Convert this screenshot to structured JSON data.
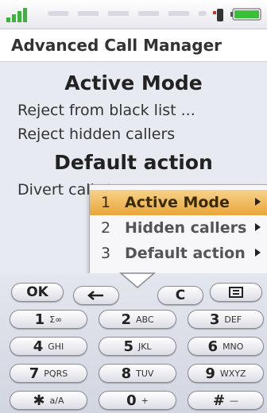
{
  "title": "Advanced Call Manager",
  "content": {
    "heading_active": "Active Mode",
    "item_blacklist": "Reject from black list ...",
    "item_hidden": "Reject hidden callers",
    "heading_default": "Default action",
    "item_divert": "Divert calls to"
  },
  "menu": [
    {
      "num": "1",
      "label": "Active Mode"
    },
    {
      "num": "2",
      "label": "Hidden callers"
    },
    {
      "num": "3",
      "label": "Default action"
    }
  ],
  "keys": {
    "ok": "OK",
    "c": "C",
    "k1": "1",
    "k1s": "Σ∞",
    "k2": "2",
    "k2s": "ABC",
    "k3": "3",
    "k3s": "DEF",
    "k4": "4",
    "k4s": "GHI",
    "k5": "5",
    "k5s": "JKL",
    "k6": "6",
    "k6s": "MNO",
    "k7": "7",
    "k7s": "PQRS",
    "k8": "8",
    "k8s": "TUV",
    "k9": "9",
    "k9s": "WXYZ",
    "kstar": "✱",
    "kstars": "a/A",
    "k0": "0",
    "k0s": "+",
    "khash": "#",
    "khashs": "—"
  },
  "colors": {
    "selected": "#eaa63a",
    "signal": "#3cb43c",
    "battery": "#38c038"
  }
}
